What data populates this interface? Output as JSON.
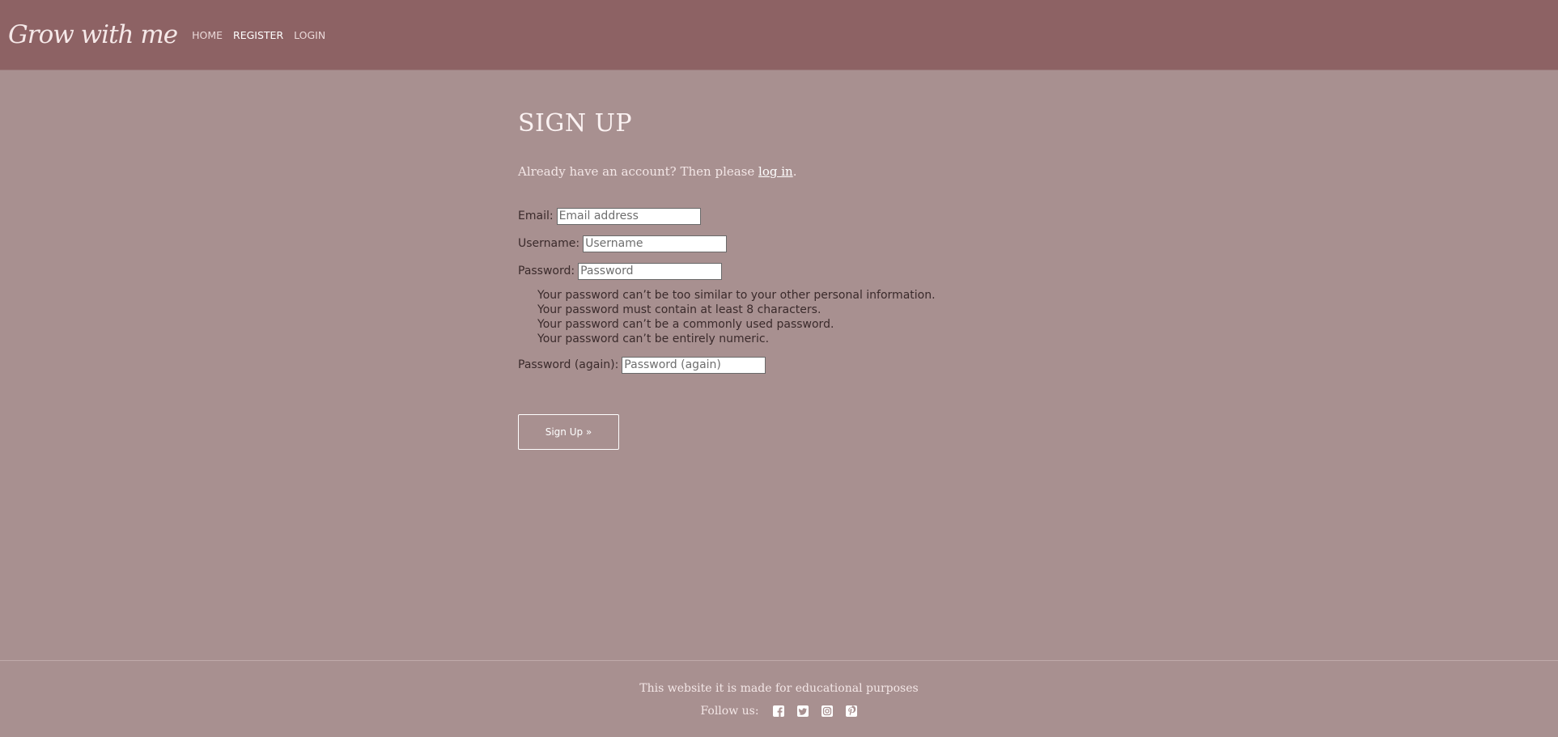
{
  "nav": {
    "brand": "Grow with me",
    "links": [
      {
        "label": "HOME",
        "active": false
      },
      {
        "label": "REGISTER",
        "active": true
      },
      {
        "label": "LOGIN",
        "active": false
      }
    ]
  },
  "main": {
    "title": "SIGN UP",
    "intro_prefix": "Already have an account? Then please ",
    "intro_link": "log in",
    "intro_suffix": ".",
    "fields": {
      "email": {
        "label": "Email:",
        "placeholder": "Email address",
        "value": ""
      },
      "username": {
        "label": "Username:",
        "placeholder": "Username",
        "value": ""
      },
      "password": {
        "label": "Password:",
        "placeholder": "Password",
        "value": ""
      },
      "password2": {
        "label": "Password (again):",
        "placeholder": "Password (again)",
        "value": ""
      }
    },
    "password_help": [
      "Your password can’t be too similar to your other personal information.",
      "Your password must contain at least 8 characters.",
      "Your password can’t be a commonly used password.",
      "Your password can’t be entirely numeric."
    ],
    "submit_label": "Sign Up »"
  },
  "footer": {
    "text": "This website it is made for educational purposes",
    "follow_label": "Follow us:",
    "social_icons": [
      "facebook-icon",
      "twitter-icon",
      "instagram-icon",
      "pinterest-icon"
    ]
  },
  "colors": {
    "header_bg": "#8d6264",
    "page_bg": "#a89090",
    "text_dark": "#3a2a2b"
  }
}
